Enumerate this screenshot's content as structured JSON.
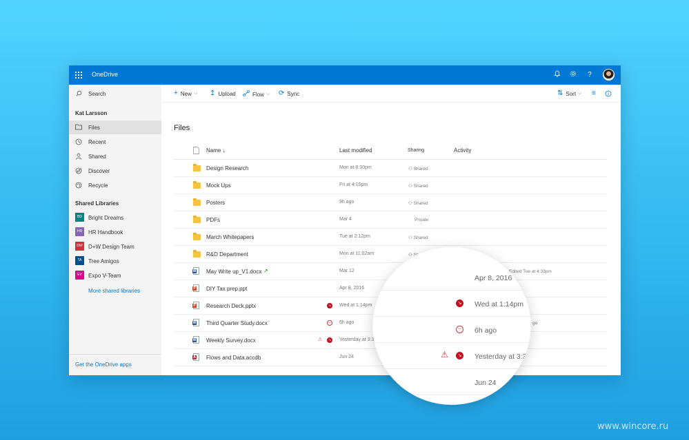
{
  "topbar": {
    "title": "OneDrive",
    "icons": [
      "waffle-icon",
      "bell-icon",
      "gear-icon",
      "help-icon",
      "avatar"
    ]
  },
  "sidebar": {
    "search_label": "Search",
    "user_name": "Kat Larsson",
    "items": [
      {
        "label": "Files",
        "icon": "folder-icon",
        "active": true
      },
      {
        "label": "Recent",
        "icon": "clock-icon"
      },
      {
        "label": "Shared",
        "icon": "person-icon"
      },
      {
        "label": "Discover",
        "icon": "discover-icon"
      },
      {
        "label": "Recycle",
        "icon": "recycle-icon"
      }
    ],
    "libraries_heading": "Shared Libraries",
    "libraries": [
      {
        "abbr": "BD",
        "label": "Bright Dreams",
        "color": "#038387"
      },
      {
        "abbr": "HR",
        "label": "HR Handbook",
        "color": "#8764b8"
      },
      {
        "abbr": "DW",
        "label": "D+W Design Team",
        "color": "#d13438"
      },
      {
        "abbr": "TA",
        "label": "Tree Amigos",
        "color": "#004e8c"
      },
      {
        "abbr": "EV",
        "label": "Expo V-Team",
        "color": "#e3008c"
      }
    ],
    "more_libraries": "More shared libraries",
    "get_apps": "Get the OneDrive apps"
  },
  "commandbar": {
    "new": "New",
    "upload": "Upload",
    "flow": "Flow",
    "sync": "Sync",
    "sort": "Sort"
  },
  "page_title": "Files",
  "columns": {
    "name": "Name ↓",
    "modified": "Last modified",
    "sharing": "Sharing",
    "activity": "Activity"
  },
  "rows": [
    {
      "name": "Design Research",
      "modified": "Mon at 8:30pm",
      "sharing": "Shared",
      "type": "folder"
    },
    {
      "name": "Mock Ups",
      "modified": "Fri at 4:10pm",
      "sharing": "Shared",
      "type": "folder"
    },
    {
      "name": "Posters",
      "modified": "9h ago",
      "sharing": "Shared",
      "type": "folder"
    },
    {
      "name": "PDFs",
      "modified": "Mar 4",
      "sharing": "Private",
      "type": "folder"
    },
    {
      "name": "March Whitepapers",
      "modified": "Tue at 2:12pm",
      "sharing": "Shared",
      "type": "folder"
    },
    {
      "name": "R&D Department",
      "modified": "Mon at 11:02am",
      "sharing": "Sh",
      "type": "folder"
    },
    {
      "name": "May Write up_V1.docx",
      "modified": "Mar 12",
      "sharing": "",
      "activity": "Edited Tue at 4:33pm",
      "type": "word"
    },
    {
      "name": "DIY Tax prep.ppt",
      "modified": "Apr 8, 2016",
      "sharing": "",
      "type": "ppt"
    },
    {
      "name": "Research Deck.pptx",
      "modified": "Wed at 1:14pm",
      "sharing": "",
      "type": "ppt"
    },
    {
      "name": "Third Quarter Study.docx",
      "modified": "6h ago",
      "sharing": "",
      "activity": "go",
      "type": "word"
    },
    {
      "name": "Weekly Survey.docx",
      "modified": "Yesterday at 3:3",
      "sharing": "",
      "type": "word"
    },
    {
      "name": "Flows and Data.accdb",
      "modified": "Jun 24",
      "sharing": "",
      "type": "access"
    }
  ],
  "magnifier": {
    "rows": [
      "Apr 8, 2016",
      "Wed at 1:14pm",
      "6h ago",
      "Yesterday at 3:3",
      "Jun 24"
    ]
  },
  "watermark": "www.wincore.ru"
}
